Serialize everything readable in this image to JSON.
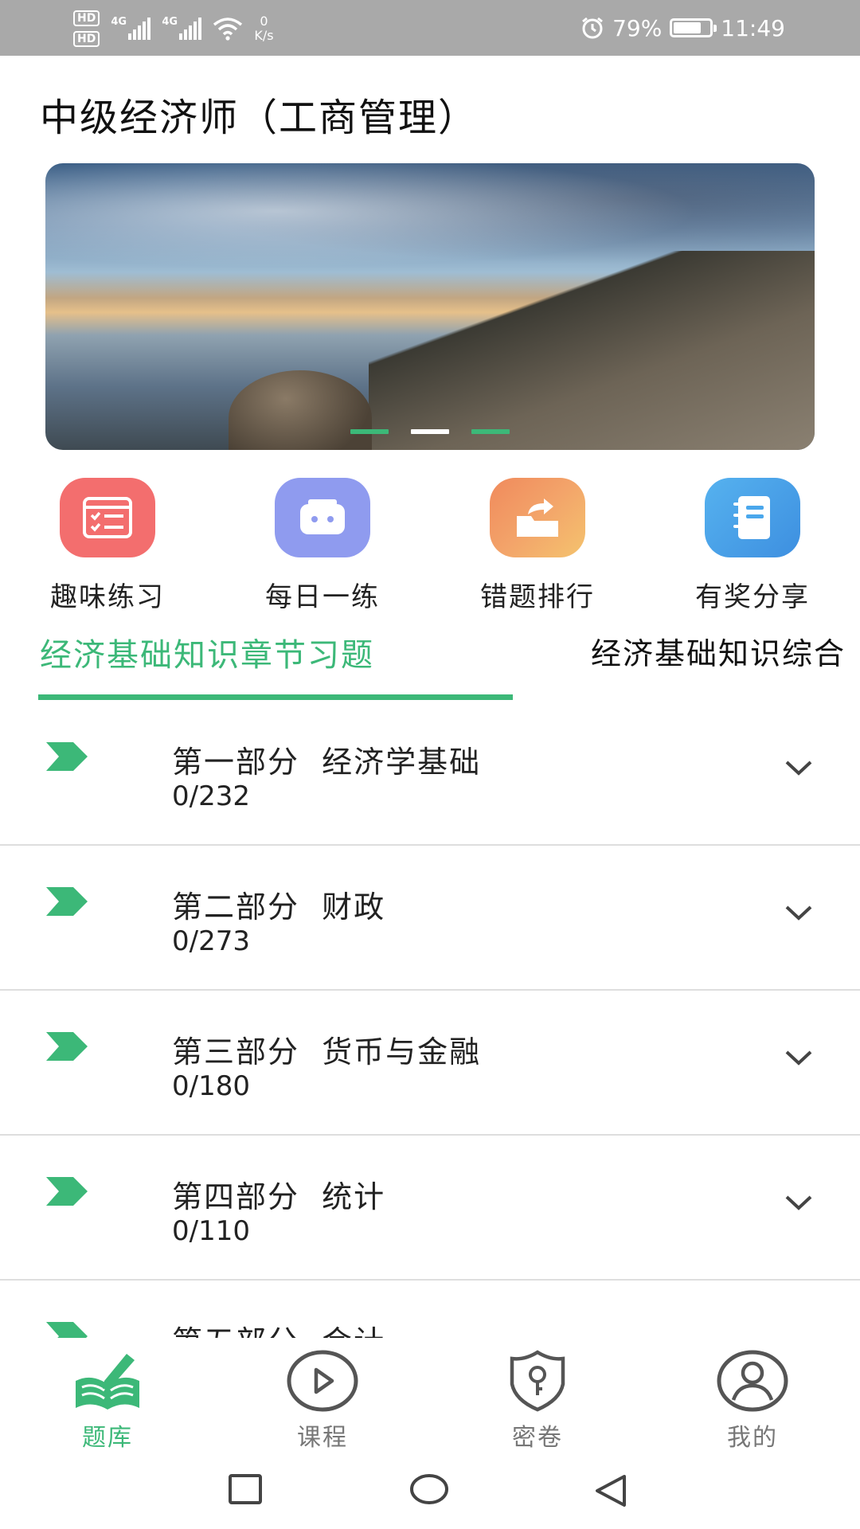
{
  "status_bar": {
    "sim1": "HD",
    "sim2": "HD",
    "net1": "4G",
    "net2": "4G",
    "speed_value": "0",
    "speed_unit": "K/s",
    "battery": "79%",
    "time": "11:49",
    "battery_level": 0.79
  },
  "page": {
    "title": "中级经济师（工商管理）"
  },
  "banner": {
    "slides": 3,
    "active_slide": 2
  },
  "shortcuts": [
    {
      "label": "趣味练习",
      "icon": "quiz-list-icon",
      "color": "#f36e6e"
    },
    {
      "label": "每日一练",
      "icon": "robot-box-icon",
      "color": "#8f9bef"
    },
    {
      "label": "错题排行",
      "icon": "folder-share-icon",
      "color": "#f39b5c"
    },
    {
      "label": "有奖分享",
      "icon": "notebook-icon",
      "color": "#4aa7ec"
    }
  ],
  "tabs": [
    {
      "label": "经济基础知识章节习题",
      "active": true
    },
    {
      "label": "经济基础知识综合",
      "active": false
    }
  ],
  "chapters": [
    {
      "title": "第一部分  经济学基础",
      "count": "0/232"
    },
    {
      "title": "第二部分  财政",
      "count": "0/273"
    },
    {
      "title": "第三部分  货币与金融",
      "count": "0/180"
    },
    {
      "title": "第四部分  统计",
      "count": "0/110"
    },
    {
      "title": "第五部分  会计",
      "count": ""
    }
  ],
  "bottom_nav": [
    {
      "label": "题库",
      "icon": "book-pen-icon",
      "active": true
    },
    {
      "label": "课程",
      "icon": "play-circle-icon",
      "active": false
    },
    {
      "label": "密卷",
      "icon": "shield-key-icon",
      "active": false
    },
    {
      "label": "我的",
      "icon": "user-circle-icon",
      "active": false
    }
  ],
  "colors": {
    "accent": "#3cb878",
    "status_bar": "#a9a9a9",
    "divider": "#dedede",
    "nav_inactive": "#777777"
  }
}
